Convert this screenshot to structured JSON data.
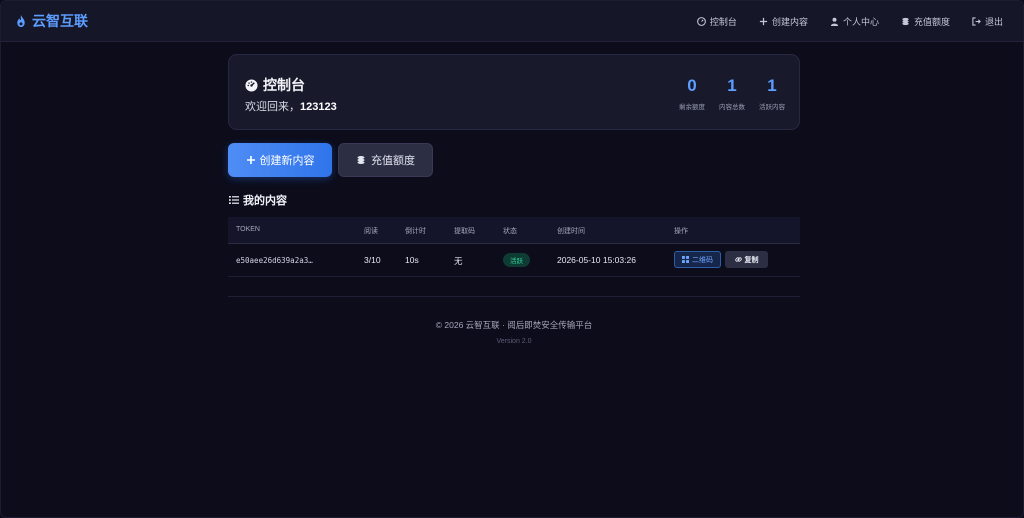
{
  "brand": {
    "name": "云智互联",
    "color": "#5c9dff"
  },
  "nav": [
    {
      "label": "控制台",
      "icon": "dashboard-icon"
    },
    {
      "label": "创建内容",
      "icon": "plus-icon"
    },
    {
      "label": "个人中心",
      "icon": "user-icon"
    },
    {
      "label": "充值额度",
      "icon": "coins-icon"
    },
    {
      "label": "退出",
      "icon": "logout-icon"
    }
  ],
  "dashboard": {
    "title": "控制台",
    "welcome_prefix": "欢迎回来，",
    "username": "123123",
    "stats": [
      {
        "value": "0",
        "label": "剩余额度"
      },
      {
        "value": "1",
        "label": "内容总数"
      },
      {
        "value": "1",
        "label": "活跃内容"
      }
    ]
  },
  "actions": {
    "create_label": "创建新内容",
    "recharge_label": "充值额度"
  },
  "content_section": {
    "title": "我的内容"
  },
  "table": {
    "columns": [
      "TOKEN",
      "阅读",
      "倒计时",
      "提取码",
      "状态",
      "创建时间",
      "操作"
    ],
    "rows": [
      {
        "token": "e50aee26d639a2a3…",
        "reads": "3/10",
        "countdown": "10s",
        "code": "无",
        "status": "活跃",
        "created": "2026-05-10 15:03:26",
        "qr_label": "二维码",
        "copy_label": "复制"
      }
    ]
  },
  "footer": {
    "copyright": "© 2026 云智互联 · 阅后即焚安全传输平台",
    "version": "Version 2.0"
  },
  "colors": {
    "accent": "#5c9dff",
    "active": "#34d399",
    "background": "#0c0c1b"
  }
}
